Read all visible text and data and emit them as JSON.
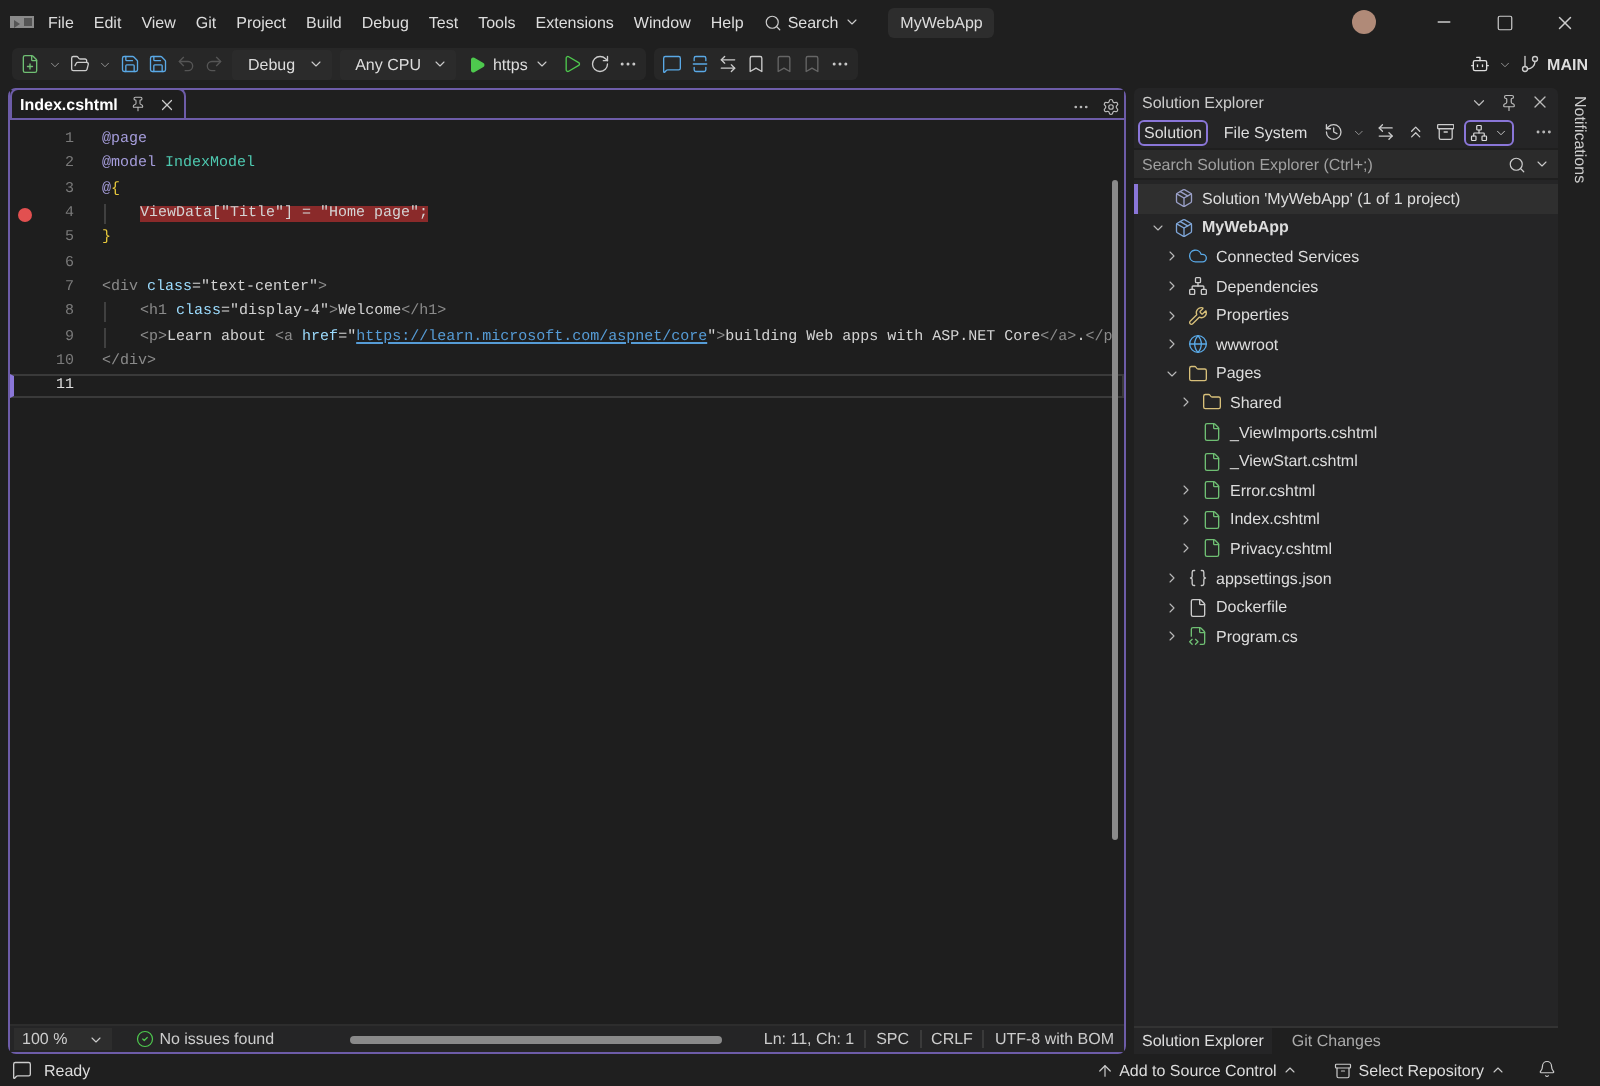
{
  "title_bar": {
    "menus": [
      "File",
      "Edit",
      "View",
      "Git",
      "Project",
      "Build",
      "Debug",
      "Test",
      "Tools",
      "Extensions",
      "Window",
      "Help"
    ],
    "search": "Search",
    "title": "MyWebApp"
  },
  "toolbar": {
    "configuration": "Debug",
    "platform": "Any CPU",
    "run_target": "https",
    "branch": "MAIN"
  },
  "editor": {
    "tabs": [
      {
        "label": "Index.cshtml",
        "selected": true
      }
    ],
    "lines": [
      {
        "number": "1",
        "breakpoint": false,
        "current": false,
        "indent": false,
        "tokens": [
          {
            "text": "@page",
            "kind": "directive"
          }
        ]
      },
      {
        "number": "2",
        "breakpoint": false,
        "current": false,
        "indent": false,
        "tokens": [
          {
            "text": "@model ",
            "kind": "directive"
          },
          {
            "text": "IndexModel",
            "kind": "type"
          }
        ]
      },
      {
        "number": "3",
        "breakpoint": false,
        "current": false,
        "indent": false,
        "tokens": [
          {
            "text": "@",
            "kind": "directive"
          },
          {
            "text": "{",
            "kind": "brace"
          }
        ]
      },
      {
        "number": "4",
        "breakpoint": true,
        "current": false,
        "indent": true,
        "tokens": [
          {
            "text": "ViewData[\"Title\"] = \"Home page\";",
            "kind": "plain"
          }
        ]
      },
      {
        "number": "5",
        "breakpoint": false,
        "current": false,
        "indent": false,
        "tokens": [
          {
            "text": "}",
            "kind": "brace"
          }
        ]
      },
      {
        "number": "6",
        "breakpoint": false,
        "current": false,
        "indent": false
      },
      {
        "number": "7",
        "breakpoint": false,
        "current": false,
        "indent": false,
        "tokens": [
          {
            "text": "<div ",
            "kind": "tag"
          },
          {
            "text": "class",
            "kind": "attr"
          },
          {
            "text": "=\"text-center\"",
            "kind": "plain"
          },
          {
            "text": ">",
            "kind": "tag"
          }
        ]
      },
      {
        "number": "8",
        "breakpoint": false,
        "current": false,
        "indent": true,
        "tokens": [
          {
            "text": "<h1 ",
            "kind": "tag"
          },
          {
            "text": "class",
            "kind": "attr"
          },
          {
            "text": "=\"display-4\"",
            "kind": "plain"
          },
          {
            "text": ">",
            "kind": "tag"
          },
          {
            "text": "Welcome",
            "kind": "plain"
          },
          {
            "text": "</h1>",
            "kind": "tag"
          }
        ]
      },
      {
        "number": "9",
        "breakpoint": false,
        "current": false,
        "indent": true,
        "tokens": [
          {
            "text": "<p>",
            "kind": "tag"
          },
          {
            "text": "Learn about ",
            "kind": "plain"
          },
          {
            "text": "<a ",
            "kind": "tag"
          },
          {
            "text": "href",
            "kind": "attr"
          },
          {
            "text": "=\"",
            "kind": "plain"
          },
          {
            "text": "https://learn.microsoft.com/aspnet/core",
            "kind": "link"
          },
          {
            "text": "\"",
            "kind": "plain"
          },
          {
            "text": ">",
            "kind": "tag"
          },
          {
            "text": "building Web apps with ASP.NET Core",
            "kind": "plain"
          },
          {
            "text": "</a>",
            "kind": "tag"
          },
          {
            "text": ".",
            "kind": "plain"
          },
          {
            "text": "</p",
            "kind": "tag"
          }
        ]
      },
      {
        "number": "10",
        "breakpoint": false,
        "current": false,
        "indent": false,
        "tokens": [
          {
            "text": "</div>",
            "kind": "tag"
          }
        ]
      },
      {
        "number": "11",
        "breakpoint": false,
        "current": true,
        "indent": false
      }
    ],
    "zoom": "100 %",
    "issues": "No issues found",
    "position": "Ln: 11, Ch: 1",
    "indentation": "SPC",
    "line_endings": "CRLF",
    "encoding": "UTF-8 with BOM"
  },
  "solution_explorer": {
    "title": "Solution Explorer",
    "views": [
      {
        "label": "Solution",
        "selected": true
      },
      {
        "label": "File System",
        "selected": false
      }
    ],
    "search": {
      "placeholder": "Search Solution Explorer (Ctrl+;)"
    },
    "tree": [
      {
        "label": "Solution 'MyWebApp' (1 of 1 project)",
        "kind": "solution",
        "selected": true
      },
      {
        "label": "MyWebApp",
        "kind": "project",
        "selected": false,
        "expanded": true,
        "children": [
          {
            "label": "Connected Services",
            "kind": "connected",
            "selected": false,
            "expanded": false
          },
          {
            "label": "Dependencies",
            "kind": "dependencies",
            "selected": false,
            "expanded": false
          },
          {
            "label": "Properties",
            "kind": "properties",
            "selected": false,
            "expanded": false
          },
          {
            "label": "wwwroot",
            "kind": "globe",
            "selected": false,
            "expanded": false
          },
          {
            "label": "Pages",
            "kind": "folder",
            "selected": false,
            "expanded": true,
            "children": [
              {
                "label": "Shared",
                "kind": "folder",
                "selected": false,
                "expanded": false
              },
              {
                "label": "_ViewImports.cshtml",
                "kind": "razor",
                "selected": false
              },
              {
                "label": "_ViewStart.cshtml",
                "kind": "razor",
                "selected": false
              },
              {
                "label": "Error.cshtml",
                "kind": "razor",
                "selected": false,
                "expanded": false
              },
              {
                "label": "Index.cshtml",
                "kind": "razor",
                "selected": false,
                "expanded": false
              },
              {
                "label": "Privacy.cshtml",
                "kind": "razor",
                "selected": false,
                "expanded": false
              }
            ]
          },
          {
            "label": "appsettings.json",
            "kind": "json",
            "selected": false,
            "expanded": false
          },
          {
            "label": "Dockerfile",
            "kind": "file",
            "selected": false,
            "expanded": false
          },
          {
            "label": "Program.cs",
            "kind": "csharp",
            "selected": false,
            "expanded": false
          }
        ]
      }
    ],
    "bottom_tabs": [
      {
        "label": "Solution Explorer",
        "selected": true
      },
      {
        "label": "Git Changes",
        "selected": false
      }
    ]
  },
  "notifications": "Notifications",
  "status_bar": {
    "state": "Ready",
    "source_control": "Add to Source Control",
    "repository": "Select Repository"
  }
}
